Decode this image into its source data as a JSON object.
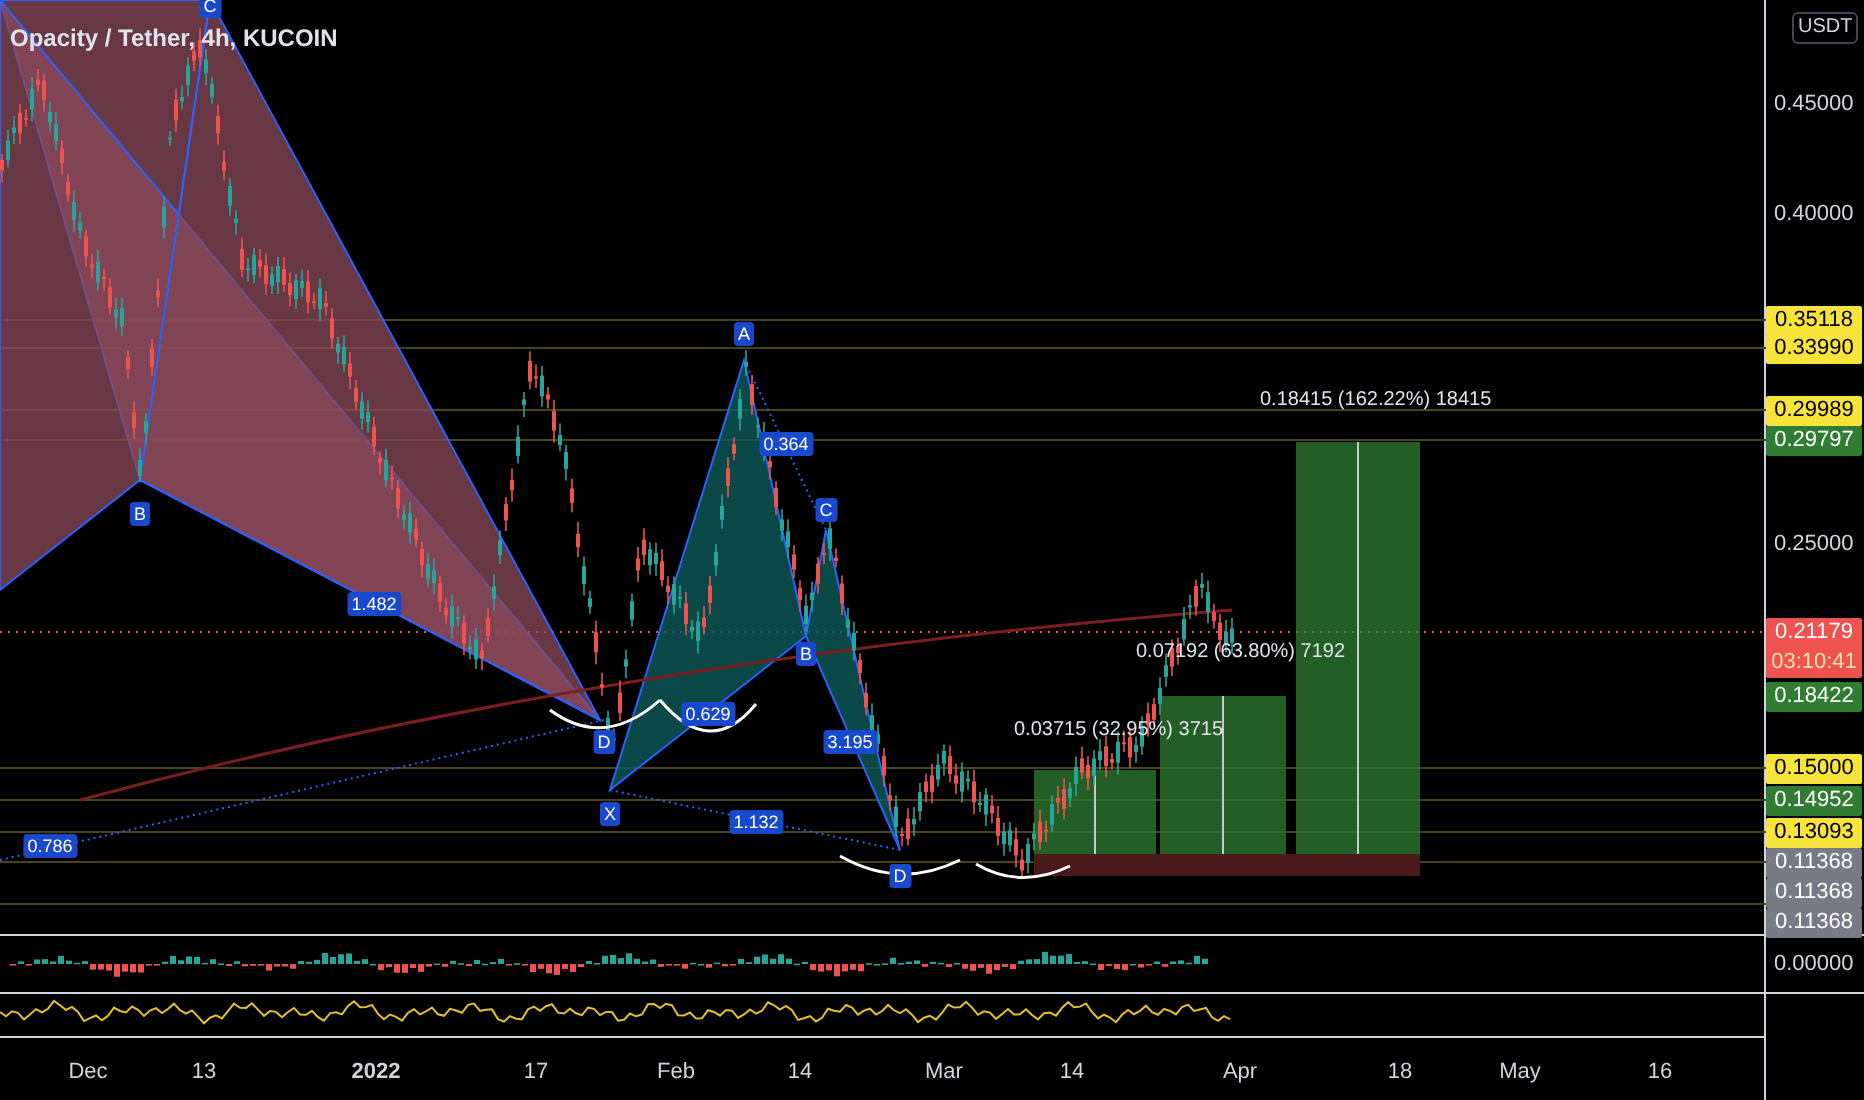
{
  "title": "Opacity / Tether, 4h, KUCOIN",
  "currency": "USDT",
  "price_axis": [
    {
      "kind": "plain",
      "text": "0.45000"
    },
    {
      "kind": "plain",
      "text": "0.40000"
    },
    {
      "kind": "tag",
      "text": "0.35118",
      "color": "#f7e43a"
    },
    {
      "kind": "tag",
      "text": "0.33990",
      "color": "#f7e43a"
    },
    {
      "kind": "tag",
      "text": "0.29989",
      "color": "#f7e43a"
    },
    {
      "kind": "tag",
      "text": "0.29797",
      "color": "#2e7d32"
    },
    {
      "kind": "plain",
      "text": "0.25000"
    },
    {
      "kind": "tag",
      "text": "0.21179",
      "color": "#ef5350",
      "countdown": "03:10:41"
    },
    {
      "kind": "tag",
      "text": "0.18422",
      "color": "#2e7d32"
    },
    {
      "kind": "tag",
      "text": "0.15000",
      "color": "#f7e43a"
    },
    {
      "kind": "tag",
      "text": "0.14952",
      "color": "#2e7d32"
    },
    {
      "kind": "tag",
      "text": "0.13093",
      "color": "#f7e43a"
    },
    {
      "kind": "tag",
      "text": "0.11368",
      "color": "#787b86"
    },
    {
      "kind": "tag",
      "text": "0.11368",
      "color": "#787b86"
    },
    {
      "kind": "tag",
      "text": "0.11368",
      "color": "#787b86"
    }
  ],
  "pattern_labels": [
    "C",
    "B",
    "1.482",
    "D",
    "X",
    "A",
    "0.364",
    "C",
    "B",
    "0.629",
    "3.195",
    "1.132",
    "D",
    "0.786"
  ],
  "measurements": [
    "0.18415 (162.22%) 18415",
    "0.07192 (63.80%) 7192",
    "0.03715 (32.95%) 3715"
  ],
  "indicator_axis": "0.00000",
  "time_axis": [
    {
      "text": "Dec",
      "emphasized": false
    },
    {
      "text": "13",
      "emphasized": false
    },
    {
      "text": "2022",
      "emphasized": true
    },
    {
      "text": "17",
      "emphasized": false
    },
    {
      "text": "Feb",
      "emphasized": false
    },
    {
      "text": "14",
      "emphasized": false
    },
    {
      "text": "Mar",
      "emphasized": false
    },
    {
      "text": "14",
      "emphasized": false
    },
    {
      "text": "Apr",
      "emphasized": false
    },
    {
      "text": "18",
      "emphasized": false
    },
    {
      "text": "May",
      "emphasized": false
    },
    {
      "text": "16",
      "emphasized": false
    }
  ]
}
